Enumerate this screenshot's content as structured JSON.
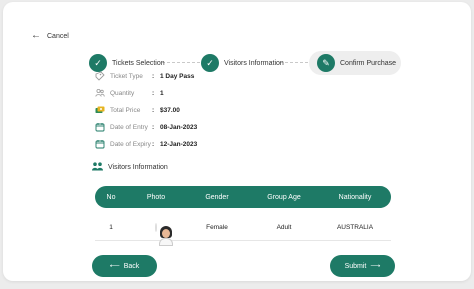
{
  "nav": {
    "cancel_label": "Cancel"
  },
  "steps": [
    {
      "label": "Tickets Selection",
      "state": "done"
    },
    {
      "label": "Visitors Information",
      "state": "done"
    },
    {
      "label": "Confirm Purchase",
      "state": "current"
    }
  ],
  "summary": {
    "ticket_type": {
      "label": "Ticket Type",
      "value": "1 Day Pass",
      "icon": "ticket-icon"
    },
    "quantity": {
      "label": "Quantity",
      "value": "1",
      "icon": "people-icon"
    },
    "total_price": {
      "label": "Total Price",
      "value": "$37.00",
      "icon": "money-icon"
    },
    "date_of_entry": {
      "label": "Date of Entry",
      "value": "08-Jan-2023",
      "icon": "calendar-icon"
    },
    "date_of_expiry": {
      "label": "Date of Expiry",
      "value": "12-Jan-2023",
      "icon": "calendar-icon"
    }
  },
  "visitors": {
    "title": "Visitors Information",
    "columns": [
      "No",
      "Photo",
      "Gender",
      "Group Age",
      "Nationality"
    ],
    "rows": [
      {
        "no": "1",
        "gender": "Female",
        "group_age": "Adult",
        "nationality": "AUSTRALIA"
      }
    ]
  },
  "actions": {
    "back_label": "Back",
    "submit_label": "Submit"
  },
  "colors": {
    "accent": "#1e7a66"
  }
}
